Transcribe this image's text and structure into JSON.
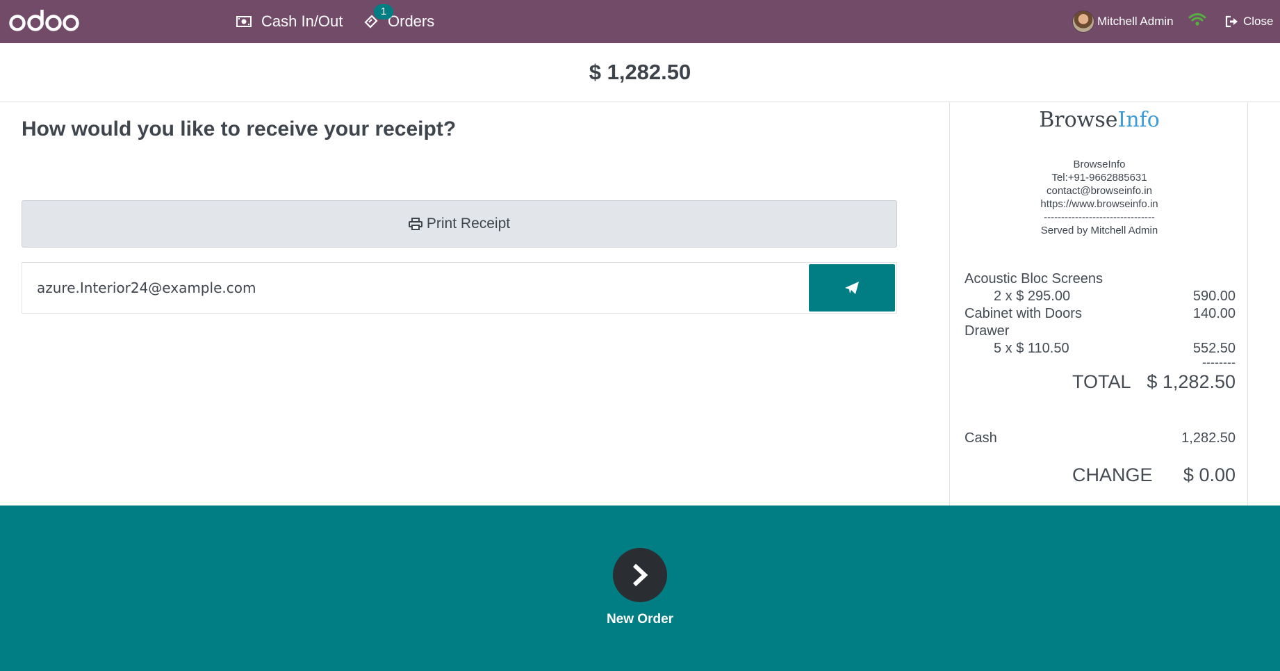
{
  "navbar": {
    "logo": "odoo",
    "cash_label": "Cash In/Out",
    "orders_label": "Orders",
    "orders_badge": "1",
    "user_name": "Mitchell Admin",
    "close_label": "Close",
    "bg_color": "#714b67"
  },
  "header": {
    "amount": "$ 1,282.50"
  },
  "receipt_options": {
    "question": "How would you like to receive your receipt?",
    "print_label": "Print Receipt",
    "email_value": "azure.Interior24@example.com"
  },
  "receipt": {
    "brand_part1": "Browse",
    "brand_part2": "Info",
    "contact": {
      "name": "BrowseInfo",
      "tel": "Tel:+91-9662885631",
      "email": "contact@browseinfo.in",
      "website": "https://www.browseinfo.in",
      "separator": "--------------------------------",
      "served_by": "Served by Mitchell Admin"
    },
    "lines": [
      {
        "name": "Acoustic Bloc Screens",
        "qty_price": "2 x $ 295.00",
        "amount": "590.00"
      },
      {
        "name": "Cabinet with Doors",
        "amount": "140.00"
      },
      {
        "name": "Drawer",
        "qty_price": "5 x $ 110.50",
        "amount": "552.50"
      }
    ],
    "dashes": "--------",
    "total_label": "TOTAL",
    "total_value": "$ 1,282.50",
    "payment_method": "Cash",
    "payment_value": "1,282.50",
    "change_label": "CHANGE",
    "change_value": "$ 0.00"
  },
  "footer": {
    "new_order_label": "New Order",
    "bg_color": "#017e84"
  }
}
